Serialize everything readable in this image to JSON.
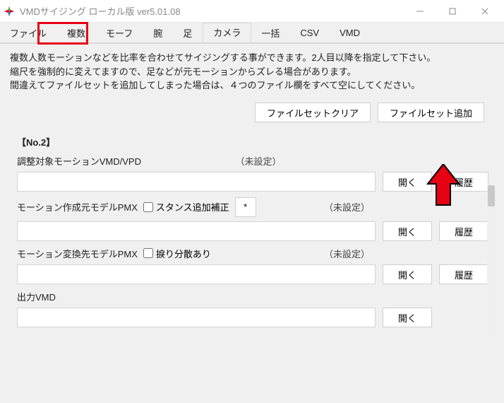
{
  "titlebar": {
    "title": "VMDサイジング ローカル版 ver5.01.08"
  },
  "tabs": {
    "items": [
      {
        "label": "ファイル"
      },
      {
        "label": "複数"
      },
      {
        "label": "モーフ"
      },
      {
        "label": "腕"
      },
      {
        "label": "足"
      },
      {
        "label": "カメラ"
      },
      {
        "label": "一括"
      },
      {
        "label": "CSV"
      },
      {
        "label": "VMD"
      }
    ],
    "highlight_index": 1,
    "active_index": 5
  },
  "description": {
    "line1": "複数人数モーションなどを比率を合わせてサイジングする事ができます。2人目以降を指定して下さい。",
    "line2": "縮尺を強制的に変えてますので、足などが元モーションからズレる場合があります。",
    "line3": "間違えてファイルセットを追加してしまった場合は、４つのファイル欄をすべて空にしてください。"
  },
  "actions": {
    "clear": "ファイルセットクリア",
    "add": "ファイルセット追加"
  },
  "section": {
    "heading": "【No.2】",
    "row1": {
      "label": "調整対象モーションVMD/VPD",
      "status": "（未設定）",
      "open": "開く",
      "history": "履歴"
    },
    "row2": {
      "label": "モーション作成元モデルPMX",
      "checkbox": "スタンス追加補正",
      "star": "*",
      "status": "（未設定）",
      "open": "開く",
      "history": "履歴"
    },
    "row3": {
      "label": "モーション変換先モデルPMX",
      "checkbox": "捩り分散あり",
      "status": "（未設定）",
      "open": "開く",
      "history": "履歴"
    },
    "row4": {
      "label": "出力VMD",
      "open": "開く"
    }
  }
}
